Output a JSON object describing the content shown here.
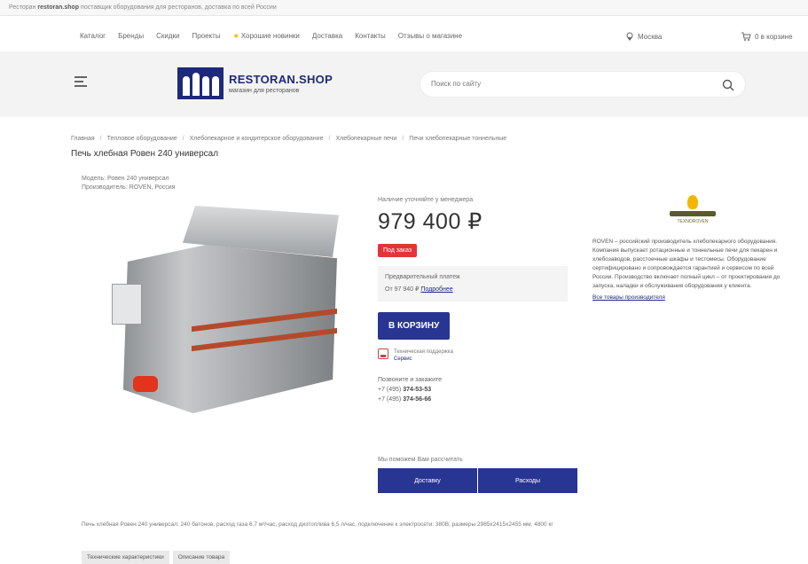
{
  "topline": {
    "prefix": "Ресторан",
    "bold": "restoran.shop",
    "rest": "поставщик оборудования для ресторанов, доставка по всей России"
  },
  "topnav": {
    "links": [
      "Каталог",
      "Бренды",
      "Скидки",
      "Проекты",
      "Хорошие новинки",
      "Доставка",
      "Контакты",
      "Отзывы о магазине"
    ],
    "city": "Москва",
    "cart": "0 в корзине"
  },
  "header": {
    "logo_title": "RESTORAN.SHOP",
    "logo_subtitle": "магазин для ресторанов",
    "search_placeholder": "Поиск по сайту"
  },
  "breadcrumb": [
    "Главная",
    "Тепловое оборудование",
    "Хлебопекарное и кондитерское оборудование",
    "Хлебопекарные печи",
    "Печи хлебопекарные тоннельные"
  ],
  "product": {
    "title": "Печь хлебная Ровен 240 универсал",
    "meta_model": "Модель: Ровен 240 универсал",
    "meta_brand": "Производитель: ROVEN, Россия",
    "price_hint": "Наличие уточняйте у менеджера",
    "price": "979 400 ₽",
    "badge": "Под заказ",
    "prepay_title": "Предварительный платеж",
    "prepay_value": "От 97 940 ₽",
    "prepay_link": "Подробнее",
    "cart_button": "В КОРЗИНУ",
    "support_text": "Техническая поддержка",
    "support_link": "Сервис",
    "phones_title": "Позвоните и закажите",
    "phone1_prefix": "+7 (495)",
    "phone1": "374-53-53",
    "phone2_prefix": "+7 (495)",
    "phone2": "374-56-66"
  },
  "brand": {
    "logo_text": "TEXNOROVEN",
    "about": "ROVEN – российский производитель хлебопекарного оборудования. Компания выпускает ротационные и тоннельные печи для пекарен и хлебозаводов, расстоечные шкафы и тестомесы. Оборудование сертифицировано и сопровождается гарантией и сервисом по всей России. Производство включает полный цикл – от проектирования до запуска, наладки и обслуживания оборудования у клиента.",
    "link": "Все товары производителя"
  },
  "alternatives": {
    "label": "Мы поможем Вам рассчитать",
    "btn1": "Доставку",
    "btn2": "Расходы"
  },
  "description": "Печь хлебная Ровен 240 универсал: 240 батонов, расход газа 6,7 м³/час, расход дизтоплива 6,5 л/час, подключение к электросети: 380В, размеры 2985х2415х2455 мм, 4800 кг",
  "tabs": [
    "Технические характеристики",
    "Описание товара"
  ]
}
